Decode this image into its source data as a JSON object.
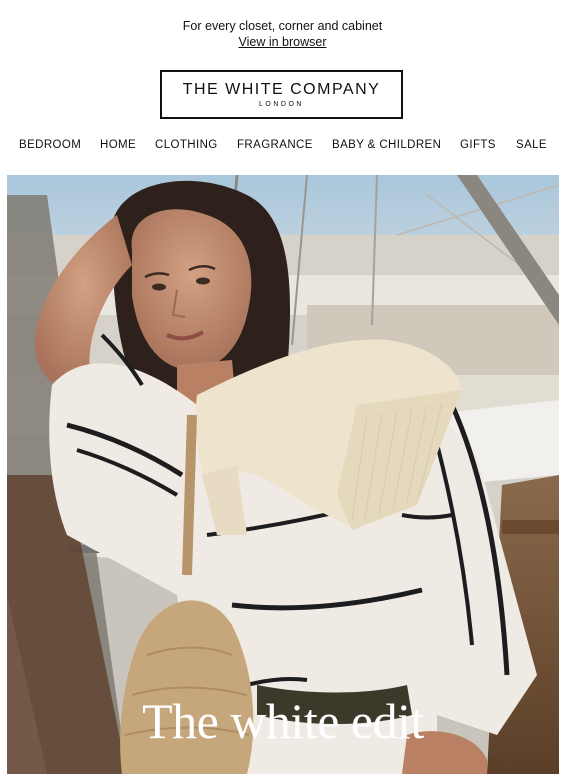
{
  "preheader": {
    "tagline": "For every closet, corner and cabinet",
    "view_in_browser": "View in browser"
  },
  "logo": {
    "brand": "THE WHITE COMPANY",
    "sub": "LONDON"
  },
  "nav": {
    "items": [
      {
        "label": "BEDROOM"
      },
      {
        "label": "HOME"
      },
      {
        "label": "CLOTHING"
      },
      {
        "label": "FRAGRANCE"
      },
      {
        "label": "BABY & CHILDREN"
      },
      {
        "label": "GIFTS"
      },
      {
        "label": "SALE"
      }
    ]
  },
  "hero": {
    "headline": "The white edit"
  }
}
